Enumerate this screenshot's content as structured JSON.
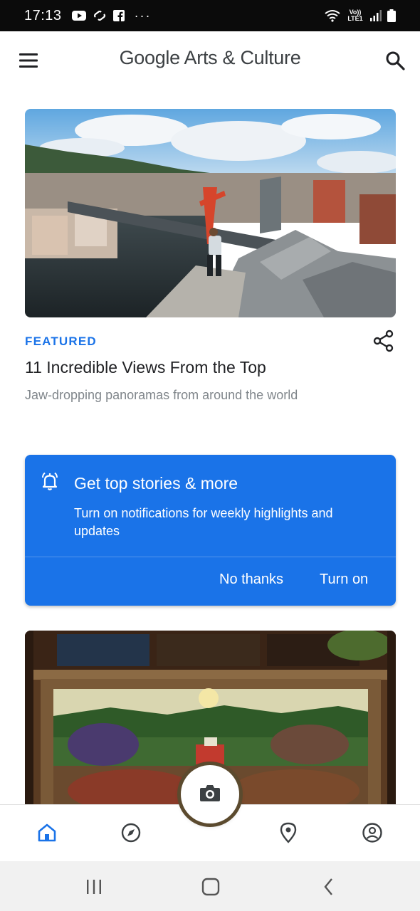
{
  "status_bar": {
    "time": "17:13",
    "dots": "···",
    "network": "Vo)) LTE1"
  },
  "app_bar": {
    "title": "Google Arts & Culture"
  },
  "featured": {
    "label": "FEATURED",
    "title": "11 Incredible Views From the Top",
    "subtitle": "Jaw-dropping panoramas from around the world"
  },
  "notification_card": {
    "title": "Get top stories & more",
    "body": "Turn on notifications for weekly highlights and updates",
    "no_thanks_label": "No thanks",
    "turn_on_label": "Turn on"
  },
  "colors": {
    "accent": "#1a73e8",
    "title_text": "#202124",
    "subtitle_text": "#80868b"
  },
  "bottom_nav": {
    "items": [
      "home-icon",
      "explore-icon",
      "camera-icon",
      "nearby-icon",
      "profile-icon"
    ],
    "active": "home-icon"
  }
}
